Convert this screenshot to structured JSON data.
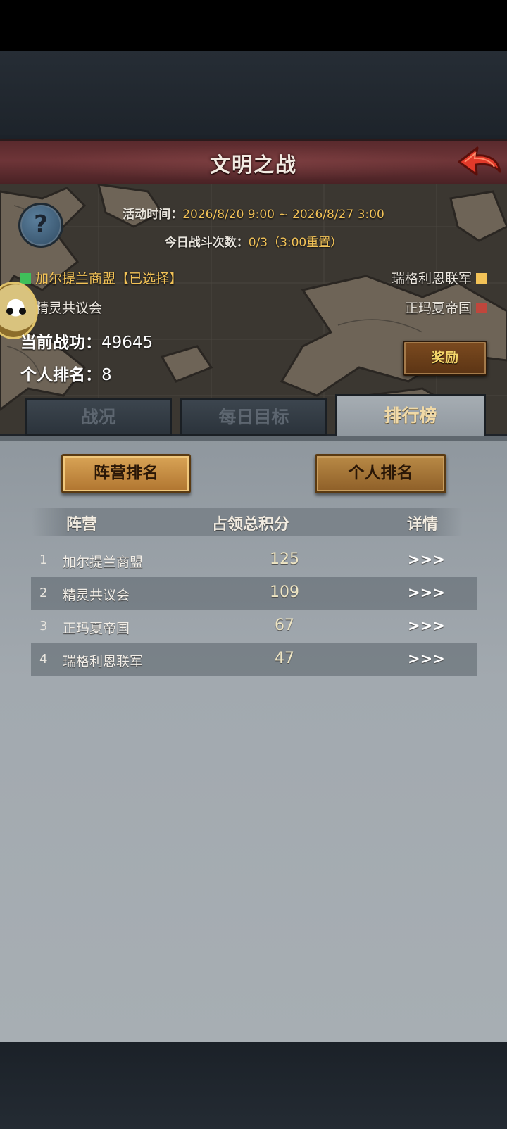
{
  "header": {
    "title": "文明之战"
  },
  "info": {
    "time_label": "活动时间：",
    "time_value": "2026/8/20 9:00 ~ 2026/8/27 3:00",
    "battles_label": "今日战斗次数：",
    "battles_value": "0/3",
    "battles_note": "（3:00重置）"
  },
  "factions": {
    "green": {
      "name": "加尔提兰商盟",
      "tag": "【已选择】",
      "color": "#3fbf5a"
    },
    "blue": {
      "name": "精灵共议会",
      "color": "#3a7fd6"
    },
    "yellow": {
      "name": "瑞格利恩联军",
      "color": "#f2c257"
    },
    "red": {
      "name": "正玛夏帝国",
      "color": "#c0463c"
    }
  },
  "stats": {
    "merit_label": "当前战功：",
    "merit_value": "49645",
    "rank_label": "个人排名：",
    "rank_value": "8"
  },
  "reward_button": "奖励",
  "tabs": [
    {
      "label": "战况",
      "active": false
    },
    {
      "label": "每日目标",
      "active": false
    },
    {
      "label": "排行榜",
      "active": true
    }
  ],
  "ranking": {
    "camp_button": "阵营排名",
    "personal_button": "个人排名",
    "headers": [
      "阵营",
      "占领总积分",
      "详情"
    ],
    "rows": [
      {
        "rank": "1",
        "name": "加尔提兰商盟",
        "score": "125",
        "detail": ">>>"
      },
      {
        "rank": "2",
        "name": "精灵共议会",
        "score": "109",
        "detail": ">>>"
      },
      {
        "rank": "3",
        "name": "正玛夏帝国",
        "score": "67",
        "detail": ">>>"
      },
      {
        "rank": "4",
        "name": "瑞格利恩联军",
        "score": "47",
        "detail": ">>>"
      }
    ]
  }
}
